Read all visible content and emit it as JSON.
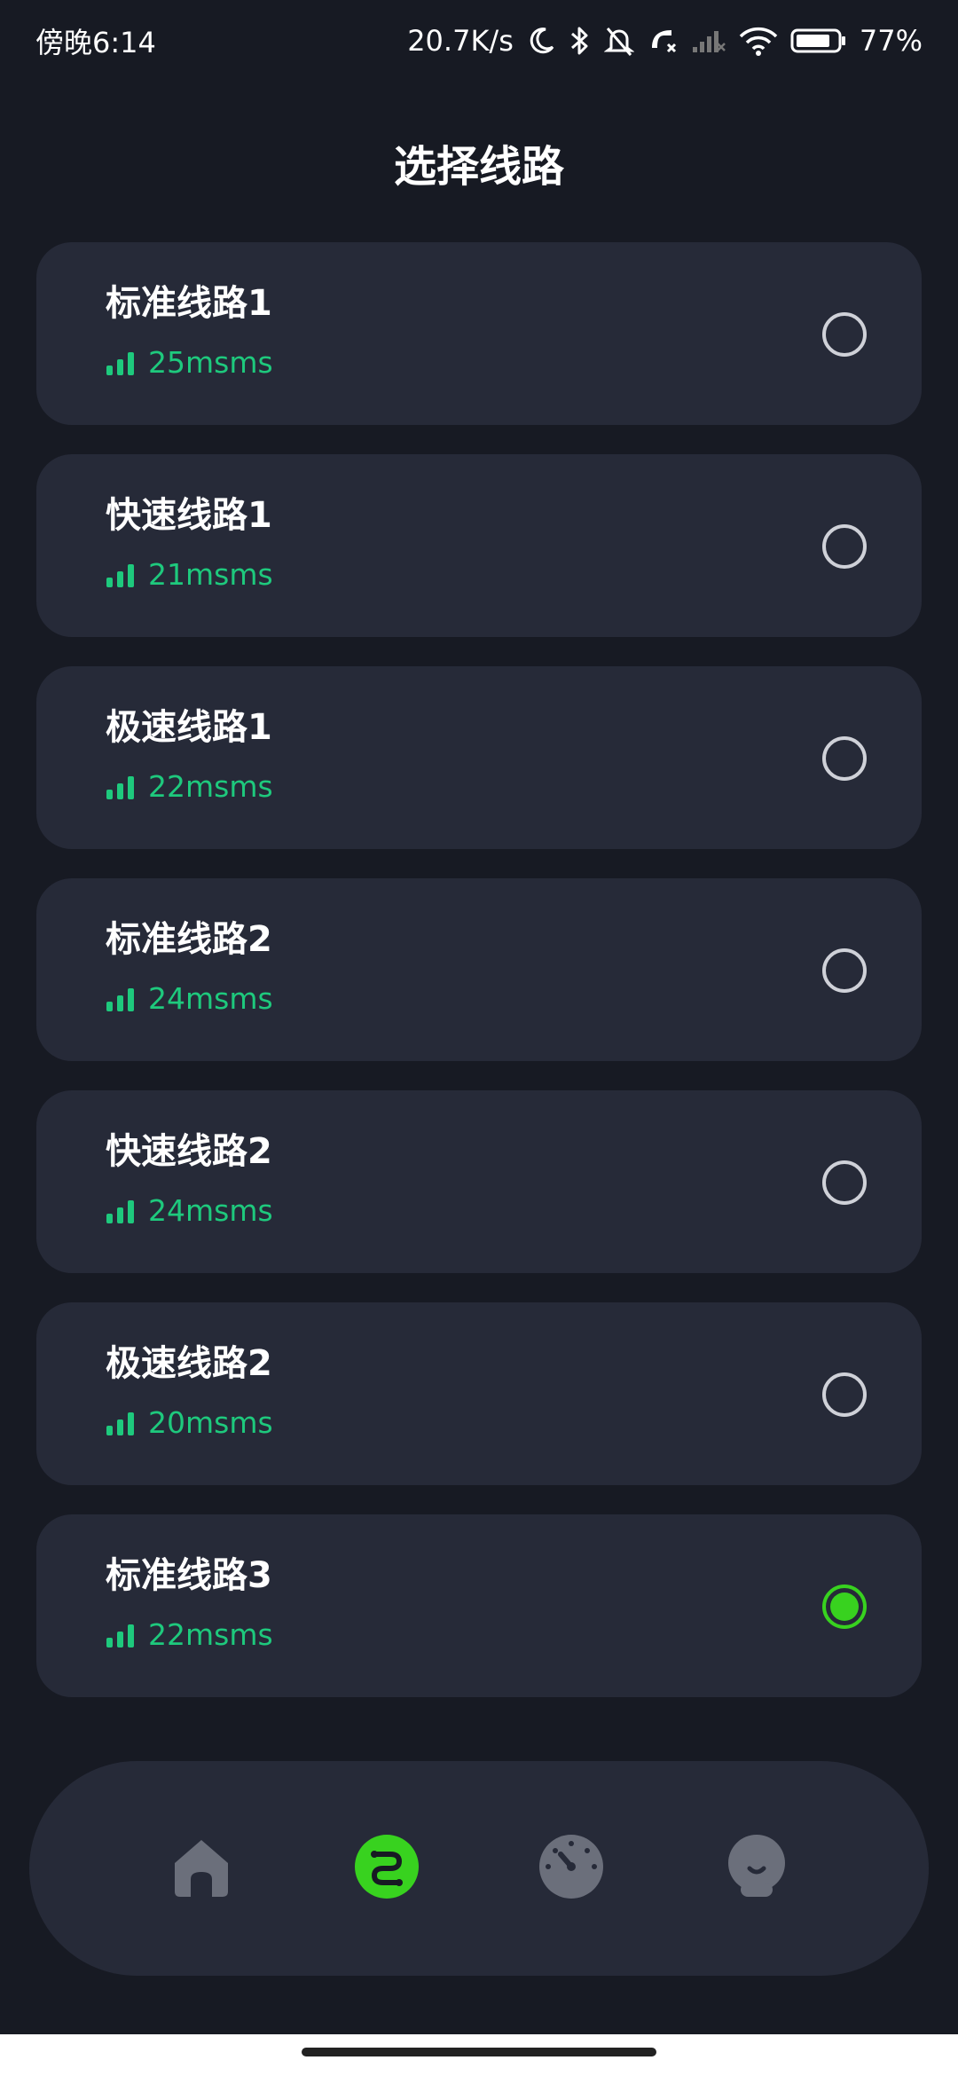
{
  "status_bar": {
    "time": "傍晚6:14",
    "net_speed": "20.7K/s",
    "battery": "77%"
  },
  "title": "选择线路",
  "routes": [
    {
      "name": "标准线路1",
      "latency": "25msms",
      "selected": false
    },
    {
      "name": "快速线路1",
      "latency": "21msms",
      "selected": false
    },
    {
      "name": "极速线路1",
      "latency": "22msms",
      "selected": false
    },
    {
      "name": "标准线路2",
      "latency": "24msms",
      "selected": false
    },
    {
      "name": "快速线路2",
      "latency": "24msms",
      "selected": false
    },
    {
      "name": "极速线路2",
      "latency": "20msms",
      "selected": false
    },
    {
      "name": "标准线路3",
      "latency": "22msms",
      "selected": true
    }
  ],
  "nav": [
    {
      "icon": "home-icon",
      "active": false
    },
    {
      "icon": "route-icon",
      "active": true
    },
    {
      "icon": "speedometer-icon",
      "active": false
    },
    {
      "icon": "profile-icon",
      "active": false
    }
  ],
  "colors": {
    "background": "#171a23",
    "card": "#262a38",
    "latency_green": "#1ec97d",
    "selected_green": "#38d21f",
    "nav_inactive": "#6b6f7b"
  }
}
